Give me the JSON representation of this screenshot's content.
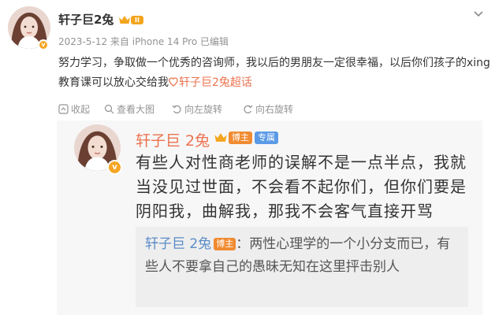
{
  "post": {
    "username": "轩子巨2兔",
    "level_badge": "II",
    "verified_badge": "v",
    "meta": "2023-5-12 来自 iPhone 14 Pro 已编辑",
    "text": "努力学习，争取做一个优秀的咨询师，我以后的男朋友一定很幸福，以后你们孩子的xing教育课可以放心交给我",
    "topic": "轩子巨2兔超话",
    "actions": {
      "favorite": "收起",
      "repost": "查看大图",
      "rotate": "向左旋转",
      "rotate2": "向右旋转"
    }
  },
  "card": {
    "name": "轩子巨 2兔",
    "tag_blogger": "博主",
    "tag_exclusive": "专属",
    "text": "有些人对性商老师的误解不是一点半点，我就当没见过世面，不会看不起你们，但你们要是阴阳我，曲解我，那我不会客气直接开骂",
    "quote": {
      "name": "轩子巨 2兔",
      "tag": "博主",
      "text": "：两性心理学的一个小分支而已，有些人不要拿自己的愚昧无知在这里抨击别人"
    }
  },
  "colors": {
    "accent": "#eb7350",
    "link": "#5a8cc8",
    "meta": "#939393",
    "badge_orange": "#f5a623",
    "tag_blue": "#5b9ae6"
  },
  "icons": [
    "chevron-down-icon",
    "crown-icon",
    "topic-icon",
    "collapse-icon",
    "zoom-icon",
    "rotate-left-icon",
    "rotate-right-icon"
  ]
}
